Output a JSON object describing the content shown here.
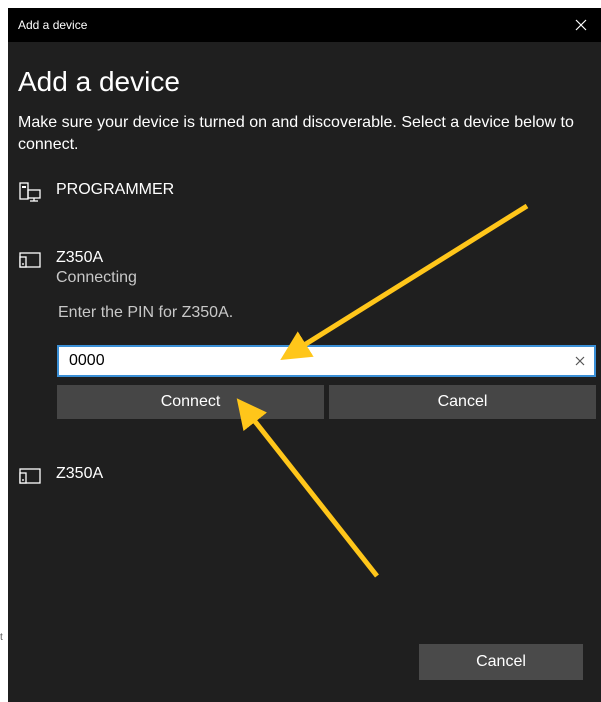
{
  "window": {
    "title": "Add a device"
  },
  "main": {
    "heading": "Add a device",
    "instructions": "Make sure your device is turned on and discoverable. Select a device below to connect."
  },
  "devices": [
    {
      "name": "PROGRAMMER",
      "status": "",
      "icon": "desktop-computer-icon"
    },
    {
      "name": "Z350A",
      "status": "Connecting",
      "icon": "tablet-device-icon"
    },
    {
      "name": "Z350A",
      "status": "",
      "icon": "tablet-device-icon"
    }
  ],
  "pin": {
    "prompt": "Enter the PIN for Z350A.",
    "value": "0000",
    "connect_label": "Connect",
    "cancel_label": "Cancel"
  },
  "footer": {
    "cancel_label": "Cancel"
  },
  "colors": {
    "window_bg": "#1f1f1f",
    "titlebar_bg": "#000000",
    "button_bg": "#464646",
    "input_border": "#3a8fd6",
    "annotation_arrow": "#ffc61a"
  }
}
